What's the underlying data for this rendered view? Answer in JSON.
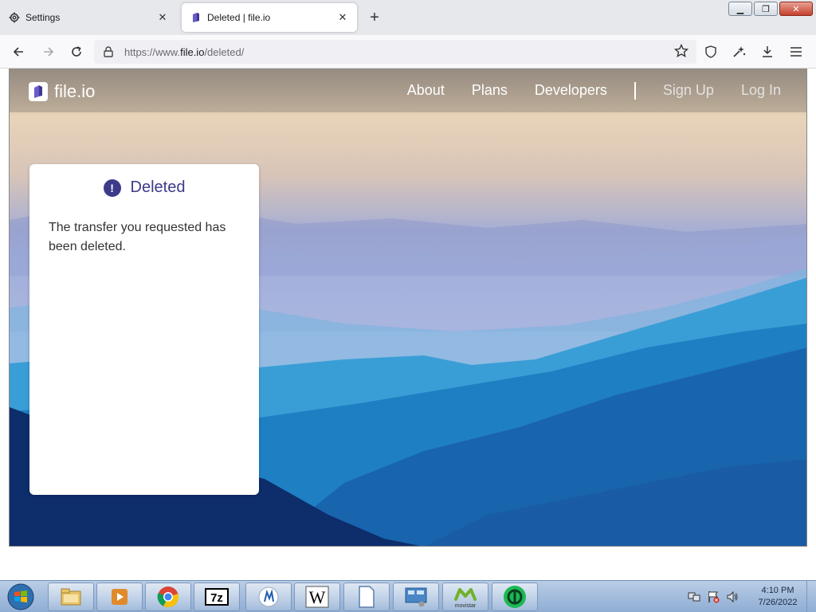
{
  "browser": {
    "tabs": [
      {
        "label": "Settings",
        "icon": "gear-icon",
        "active": false
      },
      {
        "label": "Deleted | file.io",
        "icon": "fileio-favicon",
        "active": true
      }
    ],
    "url_prefix": "https://www.",
    "url_host": "file.io",
    "url_path": "/deleted/"
  },
  "site": {
    "logo_text": "file.io",
    "nav": [
      "About",
      "Plans",
      "Developers"
    ],
    "auth": [
      "Sign Up",
      "Log In"
    ]
  },
  "card": {
    "title": "Deleted",
    "message": "The transfer you requested has been deleted."
  },
  "taskbar": {
    "apps": [
      "explorer-icon",
      "media-player-icon",
      "chrome-icon",
      "7zip-icon",
      "app-icon",
      "wordpad-icon",
      "notepad-icon",
      "control-panel-icon",
      "movistar-icon",
      "green-app-icon"
    ],
    "movistar_label": "movistar",
    "time": "4:10 PM",
    "date": "7/26/2022"
  },
  "colors": {
    "accent": "#3d3a8a",
    "header_overlay": "#786e64"
  }
}
